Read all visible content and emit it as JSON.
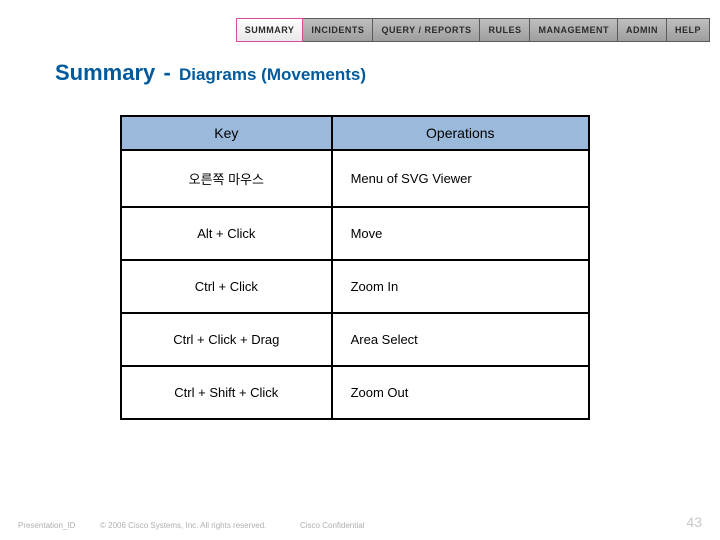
{
  "nav": {
    "tabs": [
      {
        "label": "SUMMARY",
        "active": true
      },
      {
        "label": "INCIDENTS",
        "active": false
      },
      {
        "label": "QUERY / REPORTS",
        "active": false
      },
      {
        "label": "RULES",
        "active": false
      },
      {
        "label": "MANAGEMENT",
        "active": false
      },
      {
        "label": "ADMIN",
        "active": false
      },
      {
        "label": "HELP",
        "active": false
      }
    ]
  },
  "title": {
    "main": "Summary",
    "dash": "-",
    "sub": "Diagrams  (Movements)"
  },
  "table": {
    "headers": {
      "key": "Key",
      "op": "Operations"
    },
    "rows": [
      {
        "key": "오른쪽 마우스",
        "op": "Menu of SVG Viewer"
      },
      {
        "key": "Alt + Click",
        "op": "Move"
      },
      {
        "key": "Ctrl + Click",
        "op": "Zoom In"
      },
      {
        "key": "Ctrl + Click + Drag",
        "op": "Area Select"
      },
      {
        "key": "Ctrl + Shift + Click",
        "op": "Zoom Out"
      }
    ]
  },
  "footer": {
    "pid": "Presentation_ID",
    "copyright": "© 2006 Cisco Systems, Inc. All rights reserved.",
    "confidential": "Cisco Confidential",
    "page": "43"
  }
}
